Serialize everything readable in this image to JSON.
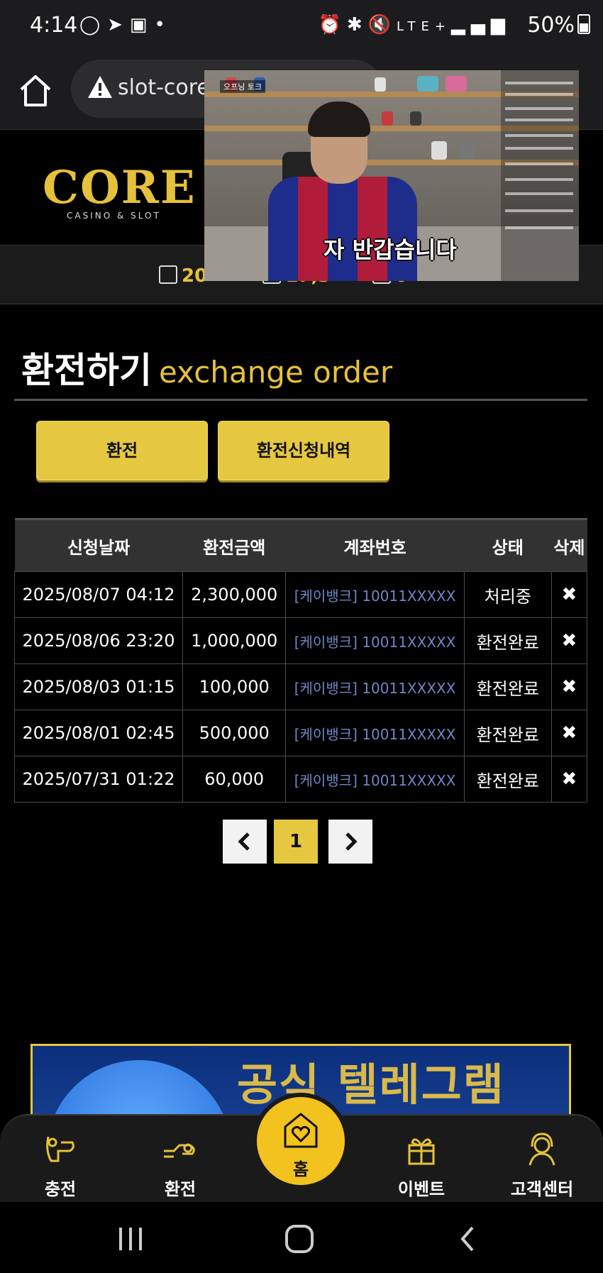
{
  "status_bar": {
    "time": "4:14",
    "network": "LTE+",
    "battery": "50%"
  },
  "browser": {
    "url": "slot-core"
  },
  "brand": {
    "logo_text": "CORE",
    "logo_sub": "CASINO & SLOT",
    "accent_color": "#e6c13a"
  },
  "info_bar": {
    "item1": "20",
    "item2": "17,3",
    "item3": "0"
  },
  "video": {
    "tag": "오프닝 토크",
    "caption": "자 반갑습니다"
  },
  "page": {
    "title_ko": "환전하기",
    "title_en": "exchange order"
  },
  "actions": {
    "exchange": "환전",
    "history": "환전신청내역"
  },
  "table": {
    "headers": {
      "date": "신청날짜",
      "amount": "환전금액",
      "account": "계좌번호",
      "status": "상태",
      "delete": "삭제"
    },
    "rows": [
      {
        "date": "2025/08/07 04:12",
        "amount": "2,300,000",
        "account": "[케이뱅크] 10011XXXXX",
        "status": "처리중"
      },
      {
        "date": "2025/08/06 23:20",
        "amount": "1,000,000",
        "account": "[케이뱅크] 10011XXXXX",
        "status": "환전완료"
      },
      {
        "date": "2025/08/03 01:15",
        "amount": "100,000",
        "account": "[케이뱅크] 10011XXXXX",
        "status": "환전완료"
      },
      {
        "date": "2025/08/01 02:45",
        "amount": "500,000",
        "account": "[케이뱅크] 10011XXXXX",
        "status": "환전완료"
      },
      {
        "date": "2025/07/31 01:22",
        "amount": "60,000",
        "account": "[케이뱅크] 10011XXXXX",
        "status": "환전완료"
      }
    ]
  },
  "pagination": {
    "current": "1"
  },
  "banner": {
    "text": "공식 텔레그램"
  },
  "bottom_nav": {
    "deposit": "충전",
    "exchange": "환전",
    "home": "홈",
    "event": "이벤트",
    "support": "고객센터"
  }
}
